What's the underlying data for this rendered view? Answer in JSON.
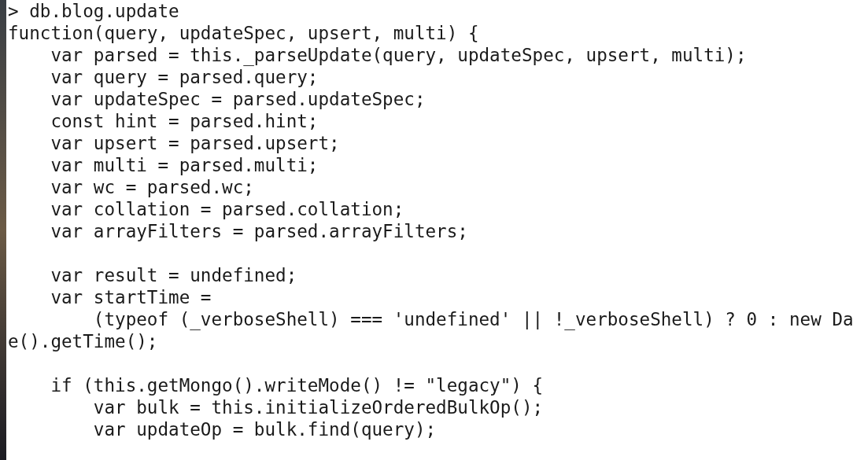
{
  "terminal": {
    "blocks": [
      [
        "> db.blog.update",
        "function(query, updateSpec, upsert, multi) {",
        "    var parsed = this._parseUpdate(query, updateSpec, upsert, multi);",
        "    var query = parsed.query;",
        "    var updateSpec = parsed.updateSpec;",
        "    const hint = parsed.hint;",
        "    var upsert = parsed.upsert;",
        "    var multi = parsed.multi;",
        "    var wc = parsed.wc;",
        "    var collation = parsed.collation;",
        "    var arrayFilters = parsed.arrayFilters;"
      ],
      [
        "    var result = undefined;",
        "    var startTime =",
        "        (typeof (_verboseShell) === 'undefined' || !_verboseShell) ? 0 : new Da",
        "e().getTime();"
      ],
      [
        "    if (this.getMongo().writeMode() != \"legacy\") {",
        "        var bulk = this.initializeOrderedBulkOp();",
        "        var updateOp = bulk.find(query);"
      ]
    ]
  }
}
